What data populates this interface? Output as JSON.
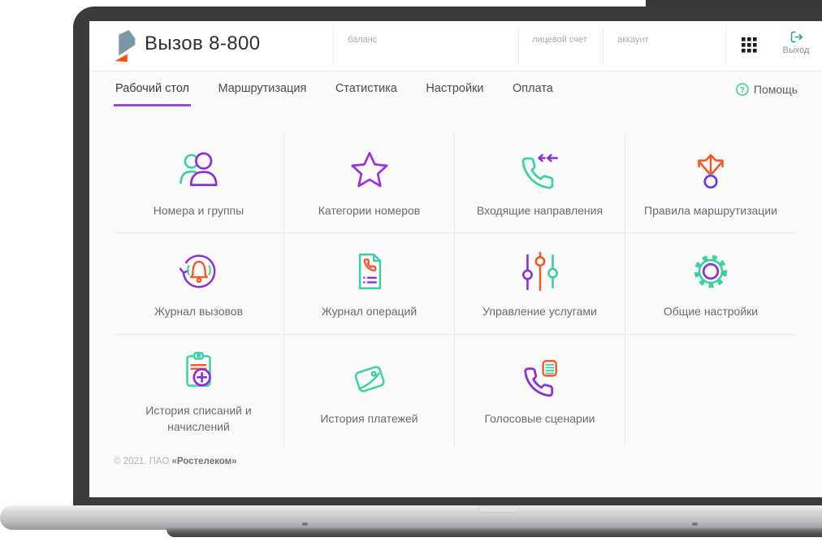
{
  "header": {
    "app_title": "Вызов 8-800",
    "balance_label": "баланс",
    "personal_account_label": "лицевой счет",
    "account_label": "аккаунт",
    "logout": {
      "label": "Выход"
    }
  },
  "nav": {
    "tabs": [
      {
        "label": "Рабочий стол",
        "active": true
      },
      {
        "label": "Маршрутизация",
        "active": false
      },
      {
        "label": "Статистика",
        "active": false
      },
      {
        "label": "Настройки",
        "active": false
      },
      {
        "label": "Оплата",
        "active": false
      }
    ],
    "help": {
      "label": "Помощь",
      "icon_glyph": "?"
    }
  },
  "grid": {
    "tiles": [
      {
        "label": "Номера и группы",
        "icon": "users-icon"
      },
      {
        "label": "Категории номеров",
        "icon": "star-icon"
      },
      {
        "label": "Входящие направления",
        "icon": "incoming-phone-icon"
      },
      {
        "label": "Правила маршрутизации",
        "icon": "routing-arrows-icon"
      },
      {
        "label": "Журнал вызовов",
        "icon": "bell-cycle-icon"
      },
      {
        "label": "Журнал операций",
        "icon": "phone-document-icon"
      },
      {
        "label": "Управление услугами",
        "icon": "sliders-icon"
      },
      {
        "label": "Общие настройки",
        "icon": "gear-icon"
      },
      {
        "label": "История списаний и начислений",
        "icon": "clipboard-plus-icon"
      },
      {
        "label": "История платежей",
        "icon": "wallet-icon"
      },
      {
        "label": "Голосовые сценарии",
        "icon": "phone-script-icon"
      }
    ]
  },
  "footer": {
    "copyright": "© 2021. ПАО ",
    "company": "«Ростелеком»"
  },
  "colors": {
    "accent_purple": "#8c2fd9",
    "accent_teal": "#3cd0a2",
    "accent_orange": "#f25a29",
    "tab_underline": "#9a4fd6",
    "logout_teal": "#2ba38f",
    "help_green": "#2fca8c",
    "logo_slate": "#7e97a6",
    "logo_orange": "#ff4e14"
  }
}
